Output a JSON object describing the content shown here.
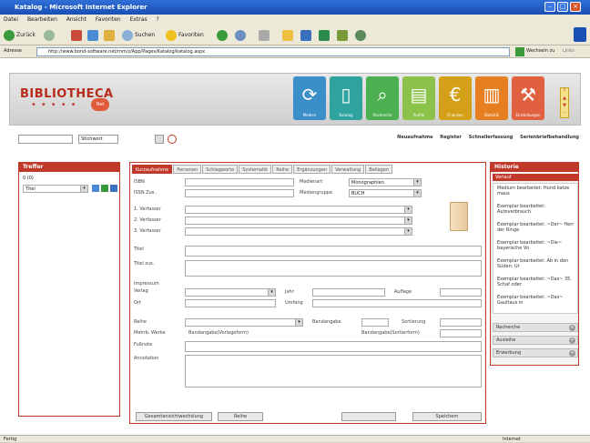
{
  "window": {
    "title": "Katalog - Microsoft Internet Explorer"
  },
  "menu": [
    "Datei",
    "Bearbeiten",
    "Ansicht",
    "Favoriten",
    "Extras",
    "?"
  ],
  "toolbar": {
    "back": "Zurück",
    "search": "Suchen",
    "favorites": "Favoriten"
  },
  "address": {
    "label": "Adresse",
    "url": "http://www.bond-software.net/mm/z/App/Pages/Katalog/katalog.aspx",
    "go": "Wechseln zu",
    "links": "Links"
  },
  "status": {
    "left": "Fertig",
    "right": "Internet"
  },
  "logo": {
    "text": "BIBLIOTHECA",
    "sub": "Net"
  },
  "modules": [
    {
      "name": "Medien",
      "icon": "⟳",
      "color": "#3a8fc8"
    },
    {
      "name": "Katalog",
      "icon": "▯",
      "color": "#2fa3a0"
    },
    {
      "name": "Recherche",
      "icon": "⌕",
      "color": "#4caf50"
    },
    {
      "name": "Profile",
      "icon": "▤",
      "color": "#8bc34a"
    },
    {
      "name": "Finanzen",
      "icon": "€",
      "color": "#d4a017"
    },
    {
      "name": "Statistik",
      "icon": "▥",
      "color": "#e67e22"
    },
    {
      "name": "Einstellungen",
      "icon": "⚒",
      "color": "#e06040"
    }
  ],
  "search": {
    "placeholder": "",
    "type": "Stichwort"
  },
  "toplinks": [
    "Neuaufnahme",
    "Register",
    "Schnellerfassung",
    "Serienbriefbehandlung"
  ],
  "left": {
    "title": "Treffer",
    "count": "0 (0)",
    "select": "Titel"
  },
  "main": {
    "tabs": [
      "Kurzaufnahme",
      "Personen",
      "Schlagworte",
      "Systematik",
      "Reihe",
      "Ergänzungen",
      "Verwaltung",
      "Beilagen"
    ],
    "labels": {
      "isbn": "ISBN",
      "issn": "ISSN Zus.",
      "medienart": "Medienart",
      "mediengruppe": "Mediengruppe",
      "v1": "1. Verfasser",
      "v2": "2. Verfasser",
      "v3": "3. Verfasser",
      "titel": "Titel",
      "titelzus": "Titel zus.",
      "impressum": "Impressum",
      "verlag": "Verlag",
      "ort": "Ort",
      "jahr": "Jahr",
      "umfang": "Umfang",
      "auflage": "Auflage",
      "reihe": "Reihe",
      "bandangabe": "Bandangabe",
      "sortierung": "Sortierung",
      "mehrbd": "Mehrb. Werke",
      "bandangabe_vt": "Bandangabe(Vorlageform)",
      "bandangabe_st": "Bandangabe(Sortierform)",
      "fussnote": "Fußnote",
      "annotation": "Annotation"
    },
    "values": {
      "medienart": "Monographien",
      "mediengruppe": "BUCH"
    },
    "buttons": [
      "Gesamtansichtwechslung",
      "Reihe",
      "Speichern"
    ]
  },
  "history": {
    "title": "Historie",
    "subtitle": "Verlauf",
    "items": [
      "Medium bearbeitet: Hund katze maus",
      "Exemplar bearbeitet: Autoverbrauch",
      "Exemplar bearbeitet: ~Der~ Herr der Ringe",
      "Exemplar bearbeitet: ~Die~ bayerische Vo",
      "Exemplar bearbeitet: Ab in den Süden: Ur",
      "Exemplar bearbeitet: ~Das~ 35. Schaf oder",
      "Exemplar bearbeitet: ~Das~ Gaultaus in"
    ],
    "sections": [
      "Recherche",
      "Ausleihe",
      "Erwerbung"
    ]
  }
}
